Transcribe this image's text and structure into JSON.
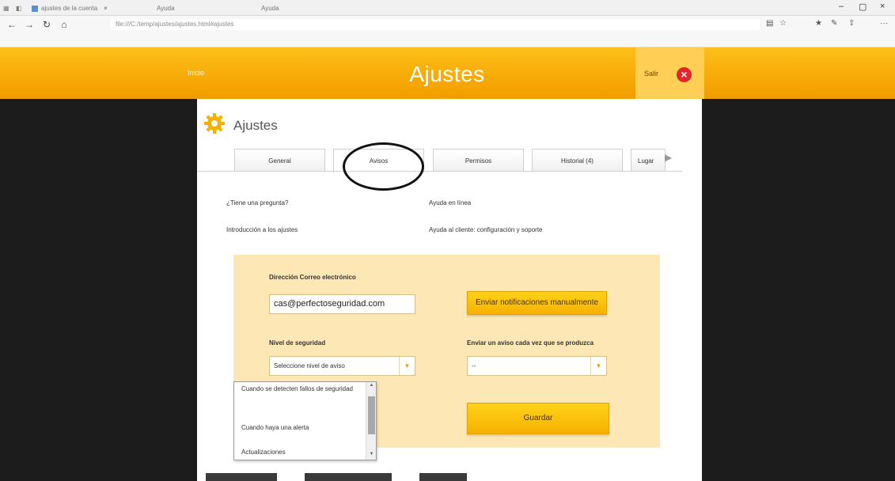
{
  "browser": {
    "tab1_title": "ajustes de la cuenta",
    "tab2_title": "Ayuda",
    "tab3_title": "Ayuda",
    "url": "file:///C:/temp/ajustes/ajustes.html#ajustes",
    "window_controls": [
      "–",
      "▢",
      "×"
    ]
  },
  "header": {
    "left_text": "Inicio",
    "title": "Ajustes",
    "exit_label": "Salir",
    "exit_icon": "close-icon",
    "accent_color": "#f5a300"
  },
  "panel": {
    "title": "Ajustes",
    "tabs": [
      {
        "label": "General",
        "active": false
      },
      {
        "label": "Avisos",
        "active": true
      },
      {
        "label": "Permisos",
        "active": false
      },
      {
        "label": "Historial (4)",
        "active": false
      },
      {
        "label": "Lugar",
        "active": false
      }
    ],
    "links": [
      "¿Tiene una pregunta?",
      "Ayuda en línea",
      "Introducción a los ajustes",
      "Ayuda al cliente: configuración y soporte"
    ]
  },
  "settings": {
    "email_label": "Dirección Correo electrónico",
    "email_value": "cas@perfectoseguridad.com",
    "send_button": "Enviar notificaciones manualmente",
    "level_label": "Nivel de seguridad",
    "level_select": "Seleccione nivel de aviso",
    "send_each_label": "Enviar un aviso cada vez que se produzca",
    "send_each_select": "--",
    "save_button": "Guardar",
    "dropdown_options": [
      "Cuando se detecten fallos de seguridad",
      "Cuando haya una alerta",
      "Actualizaciones"
    ]
  }
}
